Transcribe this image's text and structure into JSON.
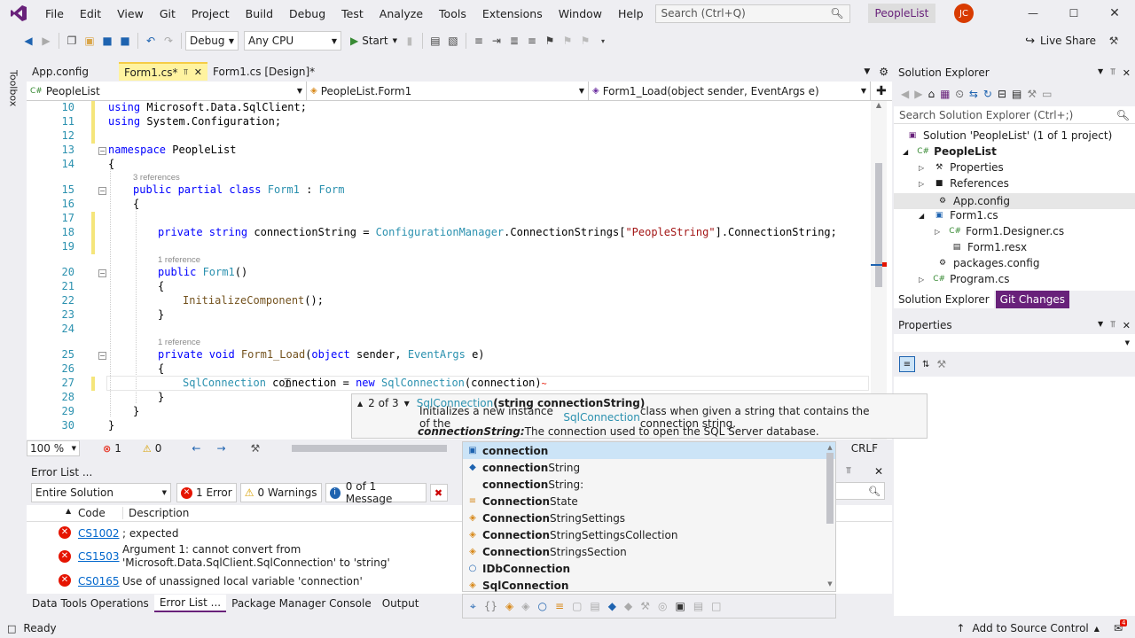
{
  "menu": [
    "File",
    "Edit",
    "View",
    "Git",
    "Project",
    "Build",
    "Debug",
    "Test",
    "Analyze",
    "Tools",
    "Extensions",
    "Window",
    "Help"
  ],
  "search": {
    "placeholder": "Search (Ctrl+Q)"
  },
  "solution_title": "PeopleList",
  "user_initials": "JC",
  "toolbar": {
    "config": "Debug",
    "platform": "Any CPU",
    "start": "Start",
    "live_share": "Live Share"
  },
  "toolbox_label": "Toolbox",
  "tabs": [
    {
      "label": "App.config"
    },
    {
      "label": "Form1.cs*"
    },
    {
      "label": "Form1.cs [Design]*"
    }
  ],
  "nav": {
    "project": "PeopleList",
    "class": "PeopleList.Form1",
    "member": "Form1_Load(object sender, EventArgs e)"
  },
  "code": {
    "line_numbers": [
      "10",
      "11",
      "12",
      "13",
      "14",
      "15",
      "16",
      "17",
      "18",
      "19",
      "20",
      "21",
      "22",
      "23",
      "24",
      "25",
      "26",
      "27",
      "28",
      "29",
      "30"
    ],
    "l10_kw": "using",
    "l10_rest": " Microsoft.Data.SqlClient;",
    "l11_kw": "using",
    "l11_rest": " System.Configuration;",
    "l13_kw": "namespace",
    "l13_rest": " PeopleList",
    "brace_open": "{",
    "brace_close": "}",
    "ref3": "3 references",
    "ref1a": "1 reference",
    "ref1b": "1 reference",
    "l15_a": "public partial class",
    "l15_b": " Form1",
    "l15_c": " : ",
    "l15_d": "Form",
    "l18_a": "private string",
    "l18_b": " connectionString = ",
    "l18_c": "ConfigurationManager",
    "l18_d": ".ConnectionStrings[",
    "l18_e": "\"PeopleString\"",
    "l18_f": "].ConnectionString;",
    "l20_a": "public",
    "l20_b": " Form1",
    "l20_c": "()",
    "l22_a": "InitializeComponent",
    "l22_b": "();",
    "l25_a": "private void",
    "l25_b": " Form1_Load",
    "l25_c": "(",
    "l25_d": "object",
    "l25_e": " sender, ",
    "l25_f": "EventArgs",
    "l25_g": " e)",
    "l27_a": "SqlConnection",
    "l27_b": " connection = ",
    "l27_c": "new",
    "l27_d": " SqlConnection",
    "l27_e": "(connection)"
  },
  "editor_status": {
    "zoom": "100 %",
    "errors": "1",
    "warnings": "0",
    "line_ending": "CRLF"
  },
  "tooltip": {
    "counter": "2 of 3",
    "signature_class": "SqlConnection",
    "signature_params": "(string connectionString)",
    "desc_pre": "Initializes a new instance of the ",
    "desc_class": "SqlConnection",
    "desc_post": " class when given a string that contains the connection string.",
    "param_name": "connectionString:",
    "param_desc": " The connection used to open the SQL Server database."
  },
  "completion": [
    {
      "text": "connection",
      "icon": "field-icon",
      "bold": "connection",
      "rest": ""
    },
    {
      "text": "connectionString",
      "icon": "field-icon",
      "bold": "connection",
      "rest": "String"
    },
    {
      "text": "connectionString:",
      "icon": "param-icon",
      "bold": "connection",
      "rest": "String:"
    },
    {
      "text": "ConnectionState",
      "icon": "enum-icon",
      "bold": "Connection",
      "rest": "State"
    },
    {
      "text": "ConnectionStringSettings",
      "icon": "class-icon",
      "bold": "Connection",
      "rest": "StringSettings"
    },
    {
      "text": "ConnectionStringSettingsCollection",
      "icon": "class-icon",
      "bold": "Connection",
      "rest": "StringSettingsCollection"
    },
    {
      "text": "ConnectionStringsSection",
      "icon": "class-icon",
      "bold": "Connection",
      "rest": "StringsSection"
    },
    {
      "text": "IDbConnection",
      "icon": "interface-icon",
      "bold": "IDbConnection",
      "rest": ""
    },
    {
      "text": "SqlConnection",
      "icon": "class-icon",
      "bold": "SqlConnection",
      "rest": ""
    }
  ],
  "error_list": {
    "title": "Error List ...",
    "scope": "Entire Solution",
    "errors_btn": "1 Error",
    "warnings_btn": "0 Warnings",
    "messages_btn": "0 of 1 Message",
    "col_code": "Code",
    "col_desc": "Description",
    "rows": [
      {
        "code": "CS1002",
        "desc": "; expected"
      },
      {
        "code": "CS1503",
        "desc": "Argument 1: cannot convert from",
        "desc2": "'Microsoft.Data.SqlClient.SqlConnection' to 'string'"
      },
      {
        "code": "CS0165",
        "desc": "Use of unassigned local variable 'connection'"
      }
    ]
  },
  "bottom_tabs": [
    "Data Tools Operations",
    "Error List ...",
    "Package Manager Console",
    "Output"
  ],
  "solution_explorer": {
    "title": "Solution Explorer",
    "search_placeholder": "Search Solution Explorer (Ctrl+;)",
    "solution": "Solution 'PeopleList' (1 of 1 project)",
    "project": "PeopleList",
    "items": [
      "Properties",
      "References",
      "App.config",
      "Form1.cs",
      "Form1.Designer.cs",
      "Form1.resx",
      "packages.config",
      "Program.cs"
    ],
    "tab1": "Solution Explorer",
    "tab2": "Git Changes"
  },
  "properties": {
    "title": "Properties"
  },
  "status": {
    "ready": "Ready",
    "source_control": "Add to Source Control",
    "notifications": "4"
  },
  "colors": {
    "accent": "#68217a",
    "selection": "#cce4f7",
    "error": "#e51400",
    "warning": "#ffcc00",
    "keyword": "#0000ff",
    "type": "#2b91af"
  }
}
